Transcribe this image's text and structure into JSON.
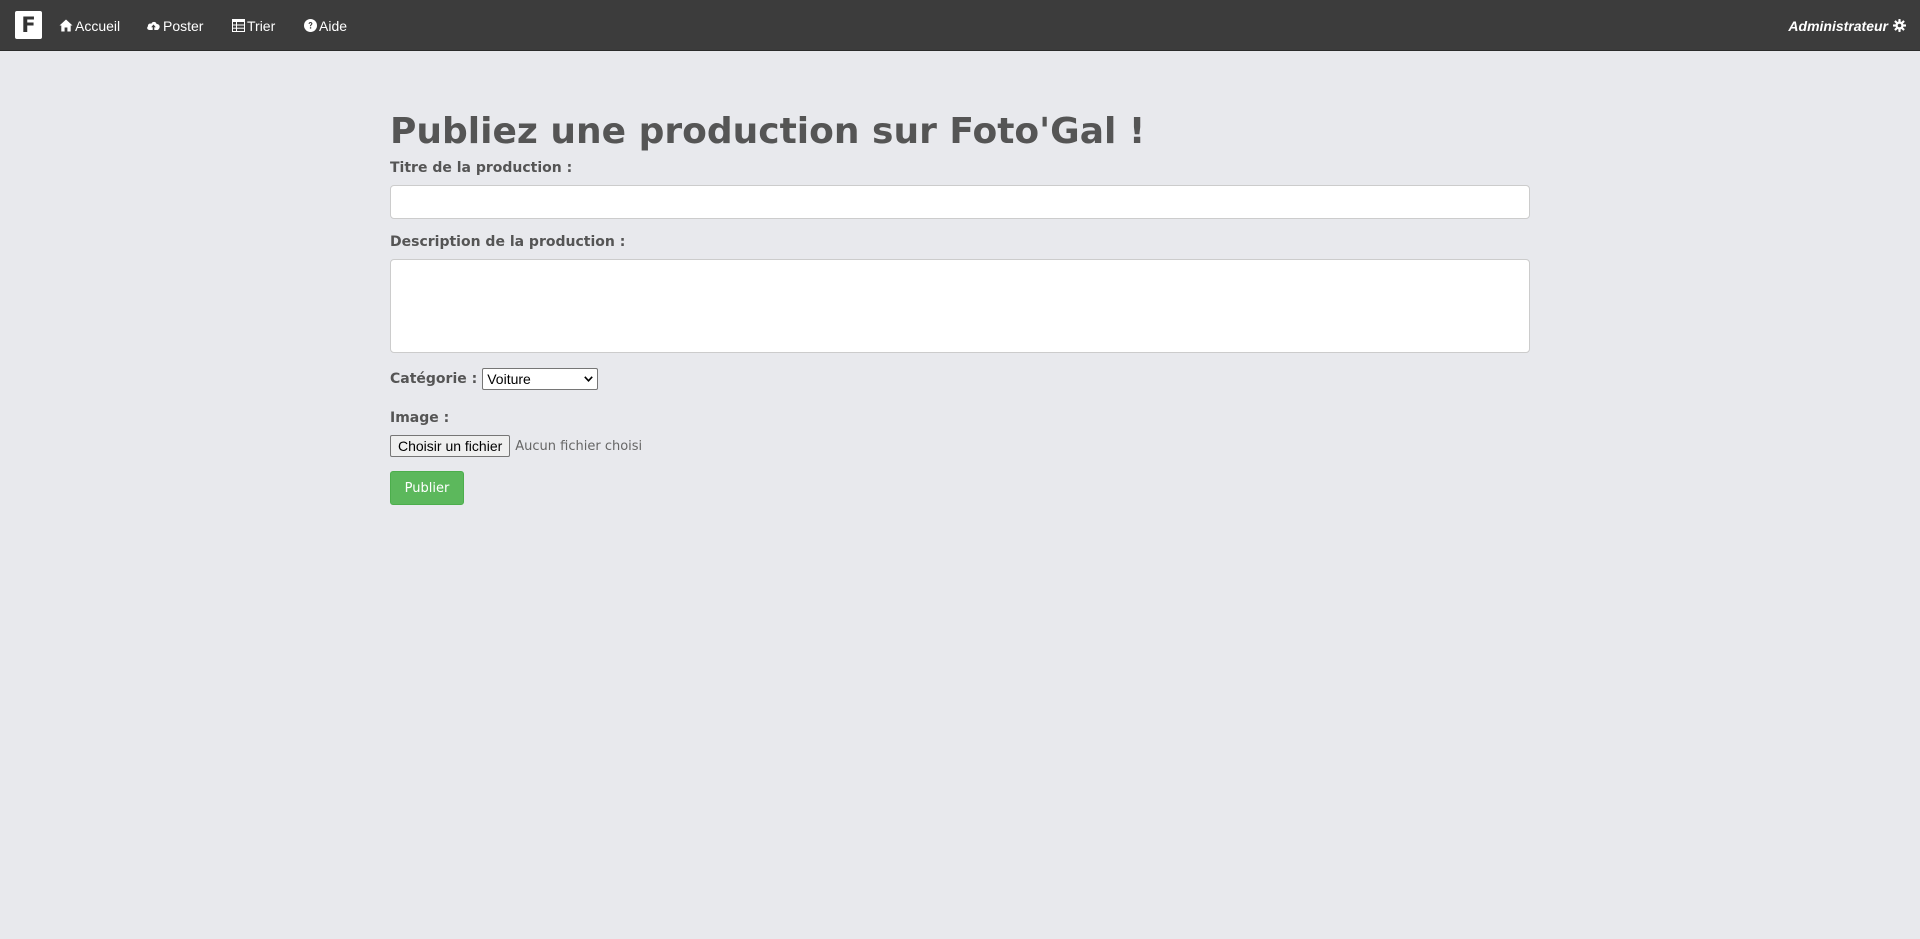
{
  "navbar": {
    "brand_letter": "F",
    "links": [
      {
        "label": "Accueil",
        "icon": "home-icon"
      },
      {
        "label": "Poster",
        "icon": "cloud-upload-icon"
      },
      {
        "label": "Trier",
        "icon": "table-icon"
      },
      {
        "label": "Aide",
        "icon": "question-circle-icon"
      }
    ],
    "user": {
      "label": "Administrateur",
      "icon": "gear-icon"
    }
  },
  "form": {
    "title": "Publiez une production sur Foto'Gal !",
    "title_label": "Titre de la production :",
    "title_value": "",
    "description_label": "Description de la production :",
    "description_value": "",
    "category_label": "Catégorie :",
    "category_selected": "Voiture",
    "image_label": "Image :",
    "file_button_label": "Choisir un fichier",
    "file_status": "Aucun fichier choisi",
    "submit_label": "Publier"
  },
  "colors": {
    "navbar_bg": "#3c3c3c",
    "page_bg": "#e8e9ed",
    "text": "#555555",
    "submit_bg": "#5cb85c"
  }
}
